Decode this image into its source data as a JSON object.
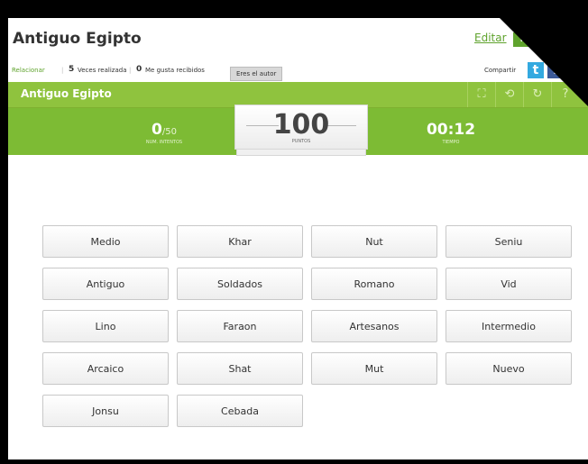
{
  "title": "Antiguo Egipto",
  "edit_label": "Editar",
  "html_label": "HTML",
  "meta": {
    "relacionar": "Relacionar",
    "times": "5",
    "times_label": "Veces realizada",
    "likes": "0",
    "likes_label": "Me gusta recibidos",
    "author": "Eres el autor",
    "share": "Compartir"
  },
  "green_title": "Antiguo Egipto",
  "tries": {
    "value": "0",
    "total": "/50",
    "label": "NUM. INTENTOS"
  },
  "score": {
    "value": "100",
    "label": "PUNTOS"
  },
  "timer": {
    "value": "00:12",
    "label": "TIEMPO"
  },
  "words": [
    "Medio",
    "Khar",
    "Nut",
    "Seniu",
    "Antiguo",
    "Soldados",
    "Romano",
    "Vid",
    "Lino",
    "Faraon",
    "Artesanos",
    "Intermedio",
    "Arcaico",
    "Shat",
    "Mut",
    "Nuevo",
    "Jonsu",
    "Cebada"
  ],
  "icons": [
    "fullscreen-icon",
    "refresh-icon",
    "restart-icon",
    "help-icon"
  ],
  "colors": {
    "green": "#8fc33e",
    "score_green": "#7dbb34"
  }
}
